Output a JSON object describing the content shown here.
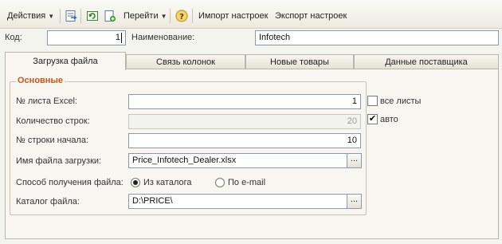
{
  "toolbar": {
    "actions_label": "Действия",
    "goto_label": "Перейти",
    "help_label": "?",
    "import_label": "Импорт настроек",
    "export_label": "Экспорт настроек"
  },
  "header": {
    "code_label": "Код:",
    "code_value": "1",
    "name_label": "Наименование:",
    "name_value": "Infotech"
  },
  "tabs": [
    {
      "label": "Загрузка файла",
      "active": true
    },
    {
      "label": "Связь колонок",
      "active": false
    },
    {
      "label": "Новые товары",
      "active": false
    },
    {
      "label": "Данные поставщика",
      "active": false
    }
  ],
  "group": {
    "title": "Основные",
    "sheet_label": "№ листа Excel:",
    "sheet_value": "1",
    "all_sheets_label": "все листы",
    "rows_label": "Количество строк:",
    "rows_value": "20",
    "auto_label": "авто",
    "start_row_label": "№ строки начала:",
    "start_row_value": "10",
    "file_name_label": "Имя файла загрузки:",
    "file_name_value": "Price_Infotech_Dealer.xlsx",
    "method_label": "Способ получения файла:",
    "method_option_catalog": "Из каталога",
    "method_option_email": "По e-mail",
    "catalog_label": "Каталог файла:",
    "catalog_value": "D:\\PRICE\\",
    "dots": "..."
  },
  "states": {
    "all_sheets_checked": false,
    "auto_checked": true,
    "method_selected": "catalog"
  },
  "colors": {
    "group_title": "#c4561c",
    "field_border": "#8a9aa8"
  }
}
